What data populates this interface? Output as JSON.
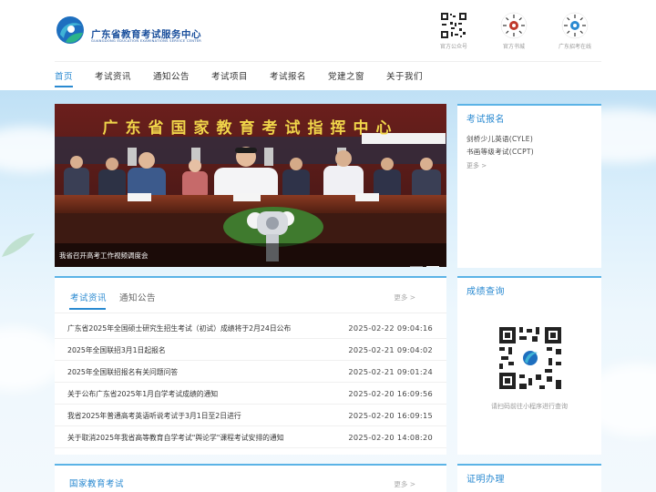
{
  "header": {
    "title": "广东省教育考试服务中心",
    "subtitle": "GUANGDONG EDUCATION EXAMINATIONS SERVICE CENTER",
    "qr_items": [
      {
        "label": "官方公众号"
      },
      {
        "label": "官方书城"
      },
      {
        "label": "广东招考在线"
      }
    ]
  },
  "nav": {
    "items": [
      "首页",
      "考试资讯",
      "通知公告",
      "考试项目",
      "考试报名",
      "党建之窗",
      "关于我们"
    ],
    "active": "首页"
  },
  "banner": {
    "caption": "我省召开高考工作视频调度会",
    "sign_text": "广东省国家教育考试指挥中心",
    "slides": 2,
    "active_slide": 2
  },
  "registration": {
    "title": "考试报名",
    "links": [
      "剑桥少儿英语(CYLE)",
      "书画等级考试(CCPT)"
    ],
    "more": "更多 >"
  },
  "score": {
    "title": "成绩查询",
    "note": "请扫码前往小程序进行查询"
  },
  "certificate": {
    "title": "证明办理"
  },
  "news": {
    "tabs": [
      "考试资讯",
      "通知公告"
    ],
    "active_tab": "考试资讯",
    "more": "更多 >",
    "items": [
      {
        "title": "广东省2025年全国硕士研究生招生考试（初试）成绩将于2月24日公布",
        "date": "2025-02-22 09:04:16"
      },
      {
        "title": "2025年全国联招3月1日起报名",
        "date": "2025-02-21 09:04:02"
      },
      {
        "title": "2025年全国联招报名有关问题问答",
        "date": "2025-02-21 09:01:24"
      },
      {
        "title": "关于公布广东省2025年1月自学考试成绩的通知",
        "date": "2025-02-20 16:09:56"
      },
      {
        "title": "我省2025年普通高考英语听说考试于3月1日至2日进行",
        "date": "2025-02-20 16:09:15"
      },
      {
        "title": "关于取消2025年我省高等教育自学考试\"舆论学\"课程考试安排的通知",
        "date": "2025-02-20 14:08:20"
      }
    ]
  },
  "national": {
    "title": "国家教育考试",
    "more": "更多 >"
  },
  "colors": {
    "accent": "#2a8ad1",
    "card_border": "#5bb3e6"
  }
}
